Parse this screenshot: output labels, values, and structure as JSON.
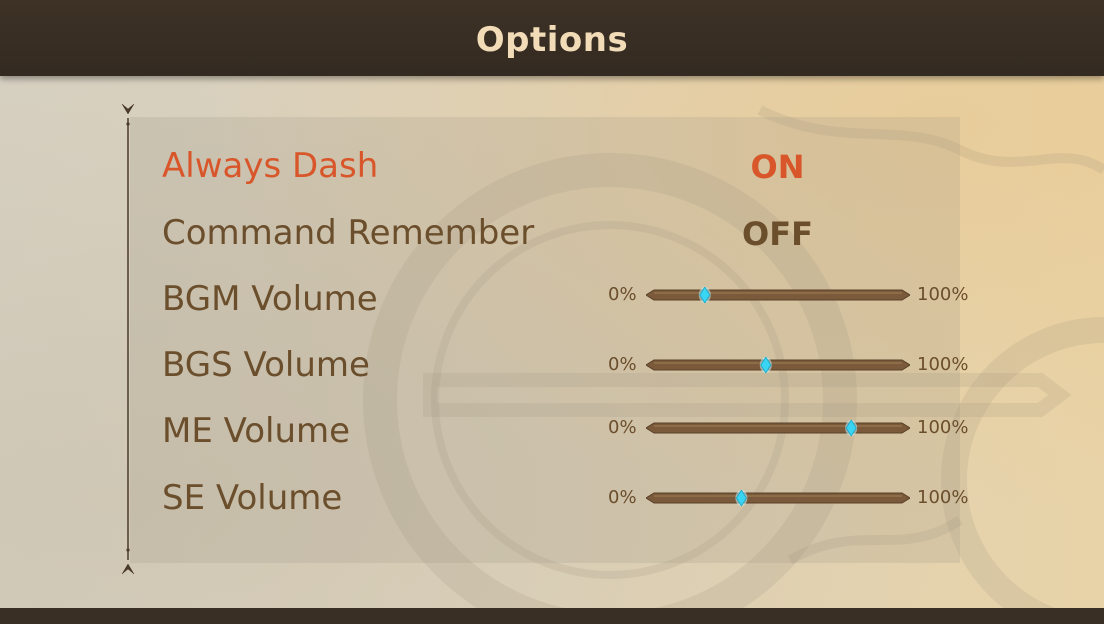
{
  "header": {
    "title": "Options"
  },
  "options": [
    {
      "label": "Always Dash",
      "value": "ON",
      "active": true
    },
    {
      "label": "Command Remember",
      "value": "OFF",
      "active": false
    }
  ],
  "volumes": [
    {
      "label": "BGM Volume",
      "min_label": "0%",
      "max_label": "100%",
      "value": 20
    },
    {
      "label": "BGS Volume",
      "min_label": "0%",
      "max_label": "100%",
      "value": 45
    },
    {
      "label": "ME Volume",
      "min_label": "0%",
      "max_label": "100%",
      "value": 80
    },
    {
      "label": "SE Volume",
      "min_label": "0%",
      "max_label": "100%",
      "value": 35
    }
  ],
  "colors": {
    "header_bg": "#3e3226",
    "title_text": "#f2dcb8",
    "label_text": "#6b4e2c",
    "active_text": "#d8562a",
    "slider_track": "#7a5a3a",
    "slider_knob": "#39d5f2"
  }
}
